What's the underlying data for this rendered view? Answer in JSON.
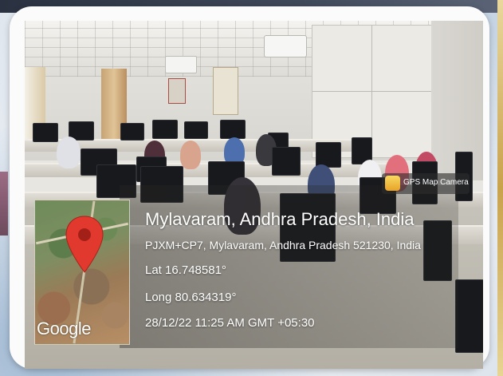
{
  "photo": {
    "scene": "computer lab with students at desktop monitors"
  },
  "app_badge": {
    "label": "GPS Map Camera",
    "icon": "gps-map-camera-icon"
  },
  "location": {
    "title": "Mylavaram, Andhra Pradesh, India",
    "address": "PJXM+CP7, Mylavaram, Andhra Pradesh 521230, India",
    "latitude": "Lat 16.748581°",
    "longitude": "Long 80.634319°",
    "datetime": "28/12/22 11:25 AM GMT +05:30"
  },
  "map": {
    "provider_logo": "Google",
    "pin_icon": "map-pin-icon",
    "pin_color": "#e1392e"
  },
  "colors": {
    "overlay_text": "#ffffff",
    "frame": "#fbfbfb",
    "backdrop": "#e6ebf1"
  }
}
